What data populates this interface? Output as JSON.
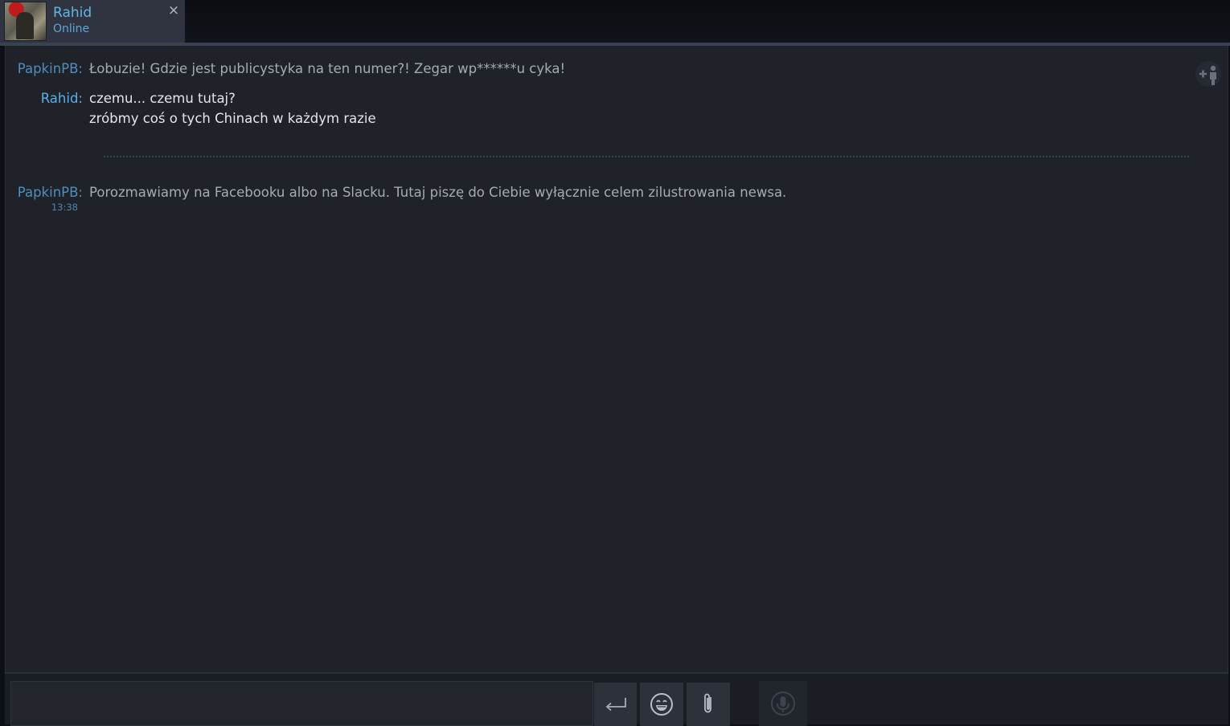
{
  "tab": {
    "name": "Rahid",
    "status": "Online",
    "close_glyph": "×"
  },
  "messages": [
    {
      "sender": "PapkinPB:",
      "lines": [
        "Łobuzie! Gdzie jest publicystyka na ten numer?! Zegar wp******u cyka!"
      ]
    },
    {
      "sender": "Rahid:",
      "lines": [
        "czemu... czemu tutaj?",
        "zróbmy coś o tych Chinach w każdym razie"
      ]
    },
    {
      "sender": "PapkinPB:",
      "lines": [
        "Porozmawiamy na Facebooku albo na Slacku. Tutaj piszę do Ciebie wyłącznie celem zilustrowania newsa."
      ],
      "time": "13:38"
    }
  ],
  "icons": {
    "add_friend": "add-friend-icon",
    "send": "enter-icon",
    "emoji": "smiley-icon",
    "attach": "paperclip-icon",
    "voice": "microphone-icon"
  },
  "colors": {
    "accent": "#62b6e8",
    "background": "#1f2229"
  }
}
